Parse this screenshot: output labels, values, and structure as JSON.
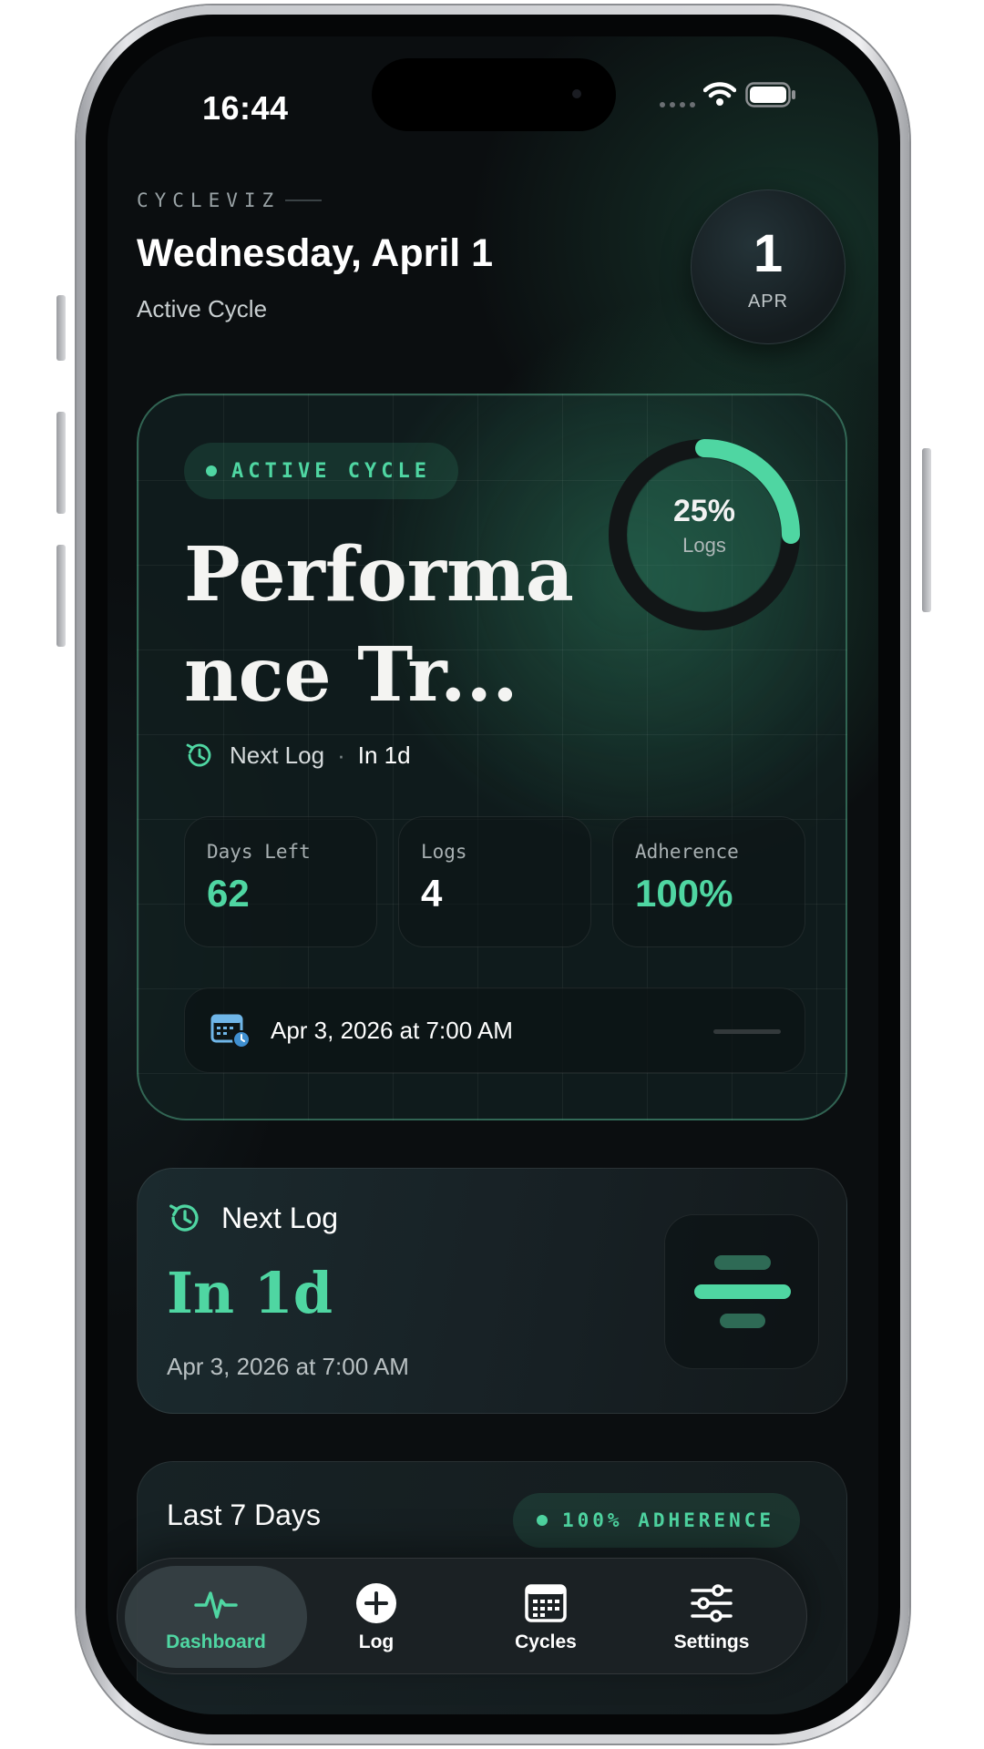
{
  "status_bar": {
    "time": "16:44"
  },
  "header": {
    "brand": "CYCLEVIZ",
    "date_title": "Wednesday, April 1",
    "subtitle": "Active Cycle",
    "badge_day": "1",
    "badge_month": "APR"
  },
  "cycle_card": {
    "pill": "ACTIVE CYCLE",
    "title": "Performance Tr...",
    "progress_percent": "25%",
    "progress_fraction": 0.25,
    "progress_label": "Logs",
    "next_log_label": "Next Log",
    "next_log_separator": "·",
    "next_log_value": "In 1d",
    "stats": [
      {
        "label": "Days Left",
        "value": "62"
      },
      {
        "label": "Logs",
        "value": "4"
      },
      {
        "label": "Adherence",
        "value": "100%"
      }
    ],
    "schedule": "Apr 3, 2026 at 7:00 AM"
  },
  "next_log_card": {
    "label": "Next Log",
    "value": "In 1d",
    "date": "Apr 3, 2026 at 7:00 AM"
  },
  "week_card": {
    "title": "Last 7 Days",
    "badge": "100% ADHERENCE"
  },
  "tabbar": {
    "tabs": [
      {
        "label": "Dashboard",
        "icon": "pulse-icon",
        "active": true
      },
      {
        "label": "Log",
        "icon": "plus-circle-icon",
        "active": false
      },
      {
        "label": "Cycles",
        "icon": "calendar-icon",
        "active": false
      },
      {
        "label": "Settings",
        "icon": "sliders-icon",
        "active": false
      }
    ]
  },
  "colors": {
    "accent": "#4fd6a2",
    "background": "#0b0e10",
    "card": "#172024"
  }
}
